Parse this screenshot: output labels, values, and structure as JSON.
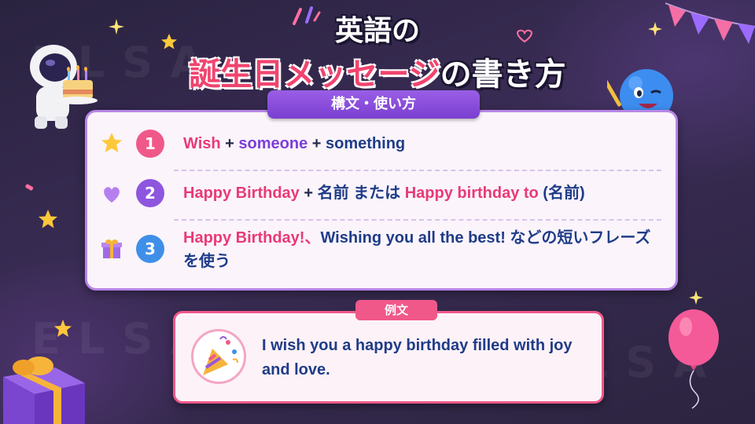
{
  "title": {
    "line1": "英語の",
    "line2_highlight": "誕生日メッセージ",
    "line2_rest": "の書き方"
  },
  "watermark": "ELSA",
  "structure": {
    "tab_label": "構文・使い方",
    "rows": [
      {
        "number": "1",
        "icon": "star-icon",
        "parts": [
          "Wish",
          " + ",
          "someone",
          " + ",
          "something"
        ]
      },
      {
        "number": "2",
        "icon": "heart-icon",
        "parts": [
          "Happy Birthday",
          " + ",
          "名前 または ",
          "Happy birthday to",
          " (名前)"
        ]
      },
      {
        "number": "3",
        "icon": "gift-icon",
        "parts": [
          "Happy Birthday!、",
          "Wishing you all the best!",
          " などの短いフレーズを使う"
        ]
      }
    ]
  },
  "example": {
    "tab_label": "例文",
    "icon": "party-popper-icon",
    "sentence": "I wish you a happy birthday filled with joy and love."
  },
  "colors": {
    "pink": "#e93a76",
    "purple": "#7b3fd6",
    "navy": "#1f3c88",
    "card_border": "#b886e6",
    "example_border": "#f0588a"
  }
}
